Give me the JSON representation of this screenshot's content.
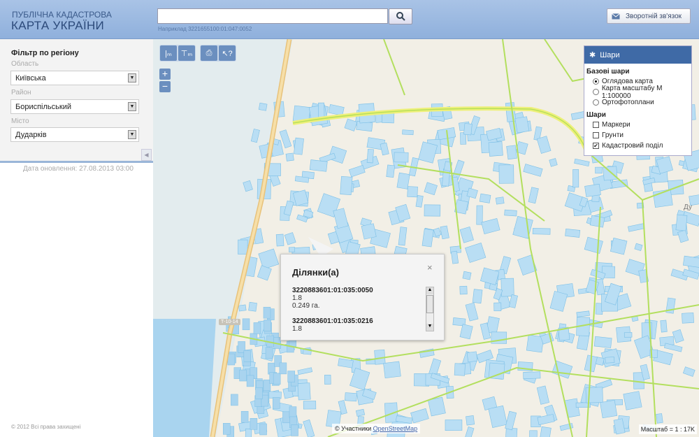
{
  "header": {
    "logo_line1": "ПУБЛІЧНА КАДАСТРОВА",
    "logo_line2": "КАРТА УКРАЇНИ",
    "search_value": "",
    "search_hint": "Наприклад 3221655100:01:047:0052",
    "feedback_label": "Зворотній зв'язок"
  },
  "filter": {
    "title": "Фільтр по регіону",
    "region_label": "Область",
    "region_value": "Київська",
    "district_label": "Район",
    "district_value": "Бориспільський",
    "city_label": "Місто",
    "city_value": "Дударків",
    "updated": "Дата оновлення: 27.08.2013 03:00",
    "copyright": "© 2012 Всі права захищені"
  },
  "layers": {
    "title": "Шари",
    "base_title": "Базові шари",
    "base": [
      {
        "label": "Оглядова карта",
        "selected": true
      },
      {
        "label": "Карта масштабу М 1:100000",
        "selected": false
      },
      {
        "label": "Ортофотоплани",
        "selected": false
      }
    ],
    "overlay_title": "Шари",
    "overlays": [
      {
        "label": "Маркери",
        "checked": false
      },
      {
        "label": "Грунти",
        "checked": false
      },
      {
        "label": "Кадастровий поділ",
        "checked": true
      }
    ]
  },
  "popup": {
    "title": "Ділянки(а)",
    "close": "×",
    "items": [
      {
        "id": "3220883601:01:035:0050",
        "purpose": "1.8",
        "area": "0.249 га."
      },
      {
        "id": "3220883601:01:035:0216",
        "purpose": "1.8",
        "area": ""
      }
    ]
  },
  "map": {
    "attribution_prefix": "© Участники",
    "attribution_link": "OpenStreetMap",
    "scale": "Масштаб = 1 : 17K",
    "road_label": "Т-10-14",
    "place_label": "Ду"
  }
}
